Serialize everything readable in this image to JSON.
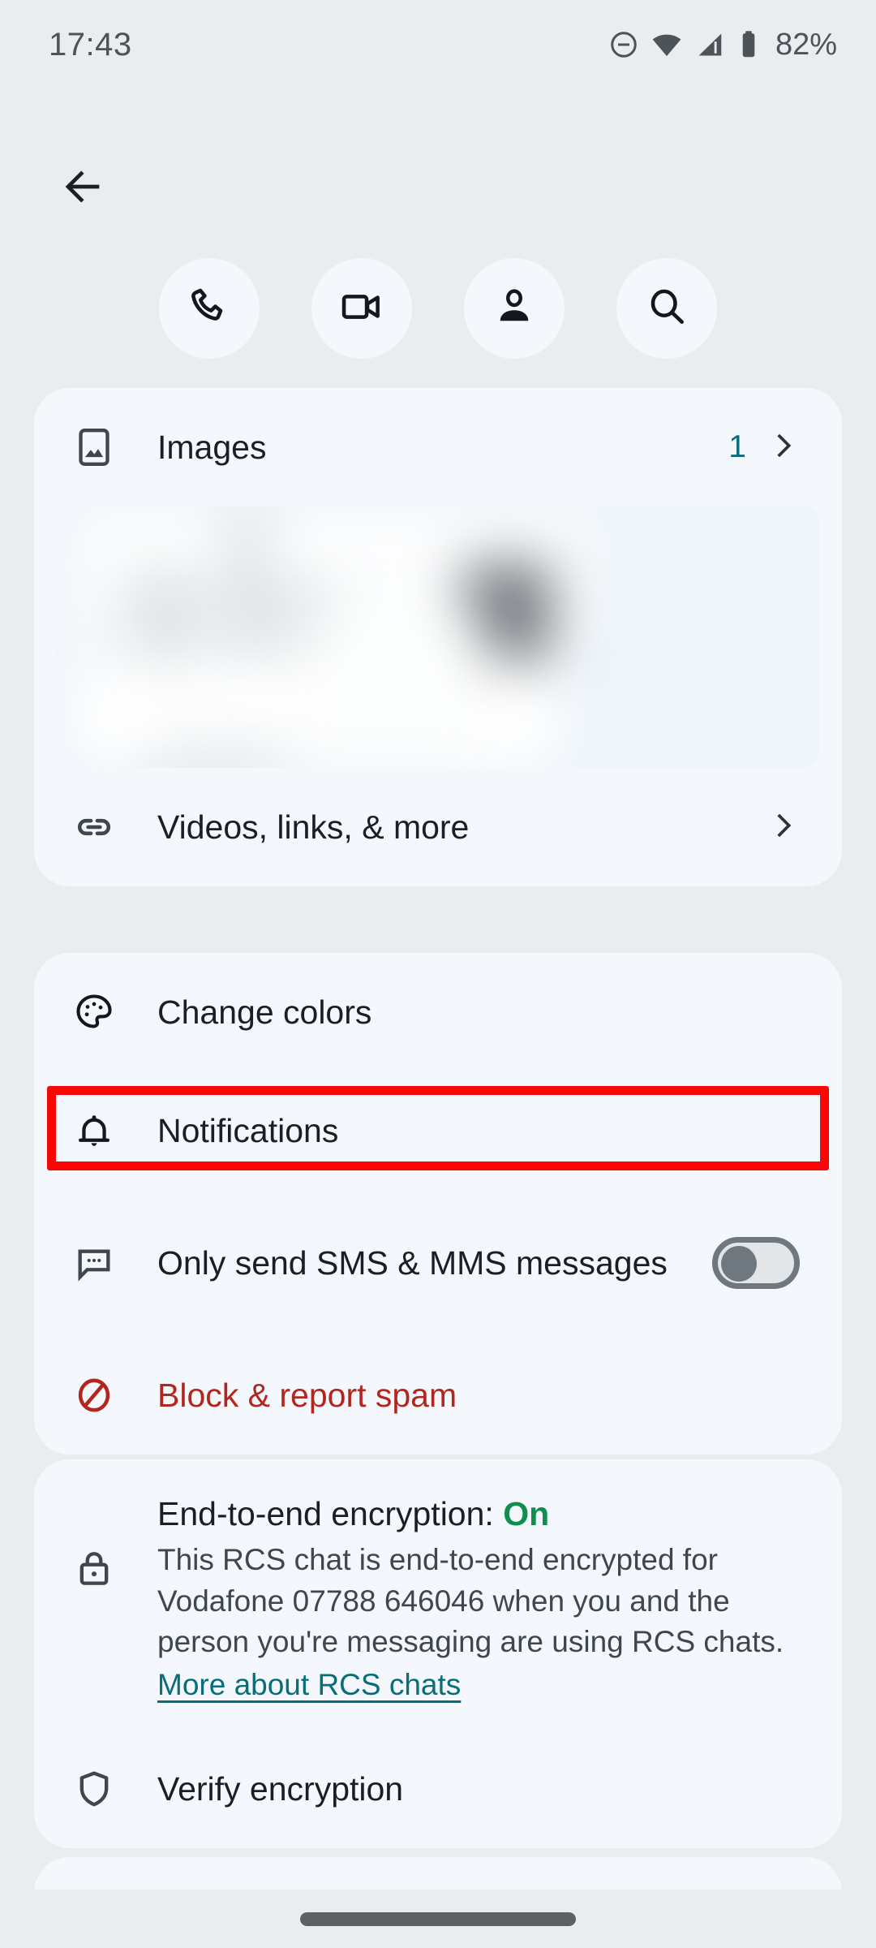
{
  "status_bar": {
    "time": "17:43",
    "battery_percent": "82%",
    "icons": [
      "dnd-icon",
      "wifi-icon",
      "cellular-signal-icon",
      "battery-icon"
    ]
  },
  "top_bar": {
    "back_icon": "arrow-back-icon"
  },
  "action_buttons": [
    {
      "name": "call-button",
      "icon": "phone-icon"
    },
    {
      "name": "video-call-button",
      "icon": "videocam-icon"
    },
    {
      "name": "contact-info-button",
      "icon": "person-icon"
    },
    {
      "name": "search-button",
      "icon": "search-icon"
    }
  ],
  "media_card": {
    "images_row": {
      "label": "Images",
      "icon": "image-icon",
      "count": "1",
      "chevron": "chevron-right-icon"
    },
    "preview": {
      "alt": "blurred-image-thumbnail"
    },
    "links_row": {
      "label": "Videos, links, & more",
      "icon": "link-icon",
      "chevron": "chevron-right-icon"
    }
  },
  "settings_card": {
    "change_colors": {
      "label": "Change colors",
      "icon": "palette-icon"
    },
    "notifications": {
      "label": "Notifications",
      "icon": "bell-icon",
      "highlighted": true
    },
    "sms_mms_only": {
      "label": "Only send SMS & MMS messages",
      "icon": "chat-bubble-icon",
      "toggle_state": "off"
    },
    "block_spam": {
      "label": "Block & report spam",
      "icon": "block-icon"
    }
  },
  "encryption_card": {
    "icon": "lock-icon",
    "title_prefix": "End-to-end encryption: ",
    "title_status": "On",
    "description": "This RCS chat is end-to-end encrypted for Vodafone 07788 646046 when you and the person you're messaging are using RCS chats.",
    "link_label": "More about RCS chats",
    "verify_row": {
      "label": "Verify encryption",
      "icon": "shield-icon"
    }
  },
  "nav_bar": {
    "handle": "gesture-nav-pill"
  },
  "colors": {
    "page_background": "#e9edf0",
    "card_background": "#f4f8fd",
    "text_primary": "#1b1f23",
    "text_secondary": "#3f474d",
    "accent_teal": "#0a6e79",
    "status_green": "#0f8f4e",
    "danger_red": "#b3261e",
    "annotation_red": "#fb0505",
    "toggle_off": "#6f787e"
  }
}
